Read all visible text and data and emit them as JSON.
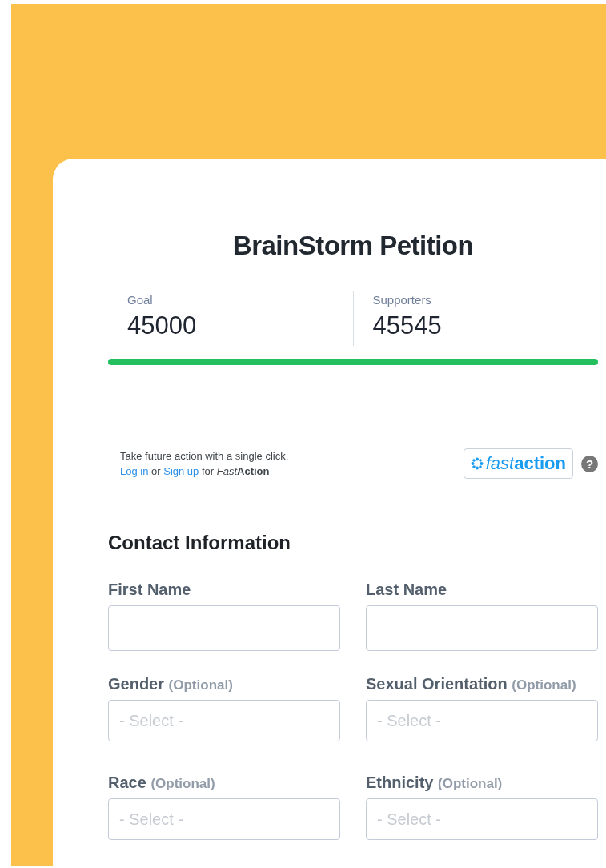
{
  "title": "BrainStorm Petition",
  "stats": [
    {
      "label": "Goal",
      "value": "45000"
    },
    {
      "label": "Supporters",
      "value": "45545"
    }
  ],
  "progress": {
    "level": 1
  },
  "fastaction": {
    "tagline": "Take future action with a single click.",
    "login_link": "Log in",
    "joiner": "or",
    "signup_link": "Sign up",
    "suffix": "for",
    "brand_light": "Fast",
    "brand_bold": "Action",
    "logo_light": "fast",
    "logo_bold": "action",
    "help": "?"
  },
  "section_title": "Contact Information",
  "fields": [
    {
      "kind": "text",
      "label": "First Name"
    },
    {
      "kind": "text",
      "label": "Last Name"
    },
    {
      "kind": "select",
      "label": "Gender",
      "hint": "(Optional)",
      "placeholder": "- Select -"
    },
    {
      "kind": "select",
      "label": "Sexual Orientation",
      "hint": "(Optional)",
      "placeholder": "- Select -"
    },
    {
      "kind": "select",
      "label": "Race",
      "hint": "(Optional)",
      "placeholder": "- Select -"
    },
    {
      "kind": "select",
      "label": "Ethnicity",
      "hint": "(Optional)",
      "placeholder": "- Select -"
    }
  ]
}
